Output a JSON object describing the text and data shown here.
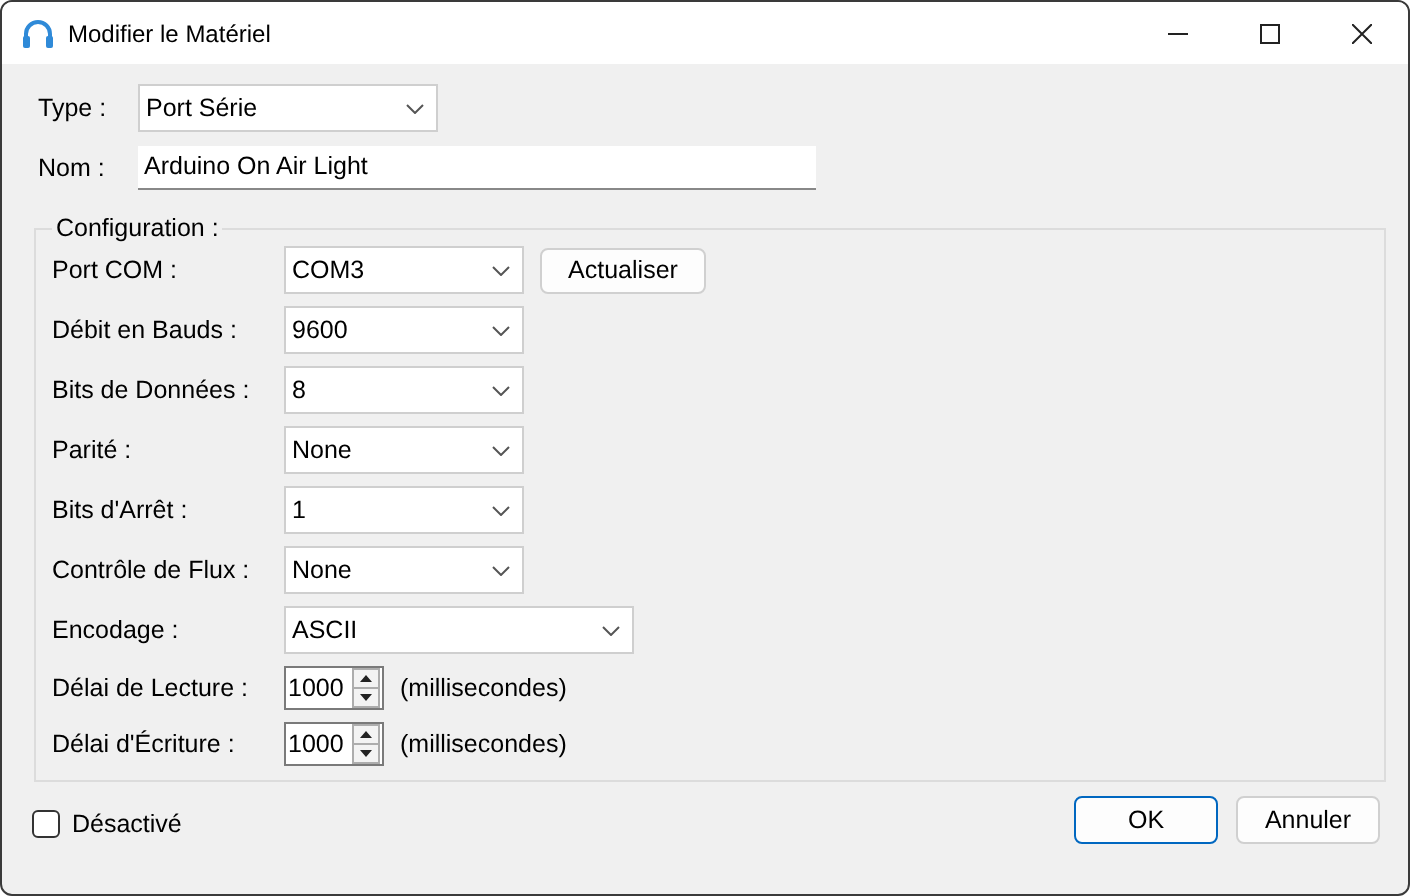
{
  "window": {
    "title": "Modifier le Matériel"
  },
  "general": [
    {
      "label": "Type :",
      "kind": "combo",
      "value": "Port Série"
    },
    {
      "label": "Nom :",
      "kind": "text",
      "value": "Arduino On Air Light"
    }
  ],
  "configuration": {
    "title": "Configuration :",
    "fields": [
      {
        "label": "Port COM :",
        "kind": "combo",
        "value": "COM3",
        "button": "Actualiser"
      },
      {
        "label": "Débit en Bauds :",
        "kind": "combo",
        "value": "9600"
      },
      {
        "label": "Bits de Données :",
        "kind": "combo",
        "value": "8"
      },
      {
        "label": "Parité :",
        "kind": "combo",
        "value": "None"
      },
      {
        "label": "Bits d'Arrêt :",
        "kind": "combo",
        "value": "1"
      },
      {
        "label": "Contrôle de Flux :",
        "kind": "combo",
        "value": "None"
      },
      {
        "label": "Encodage :",
        "kind": "wide-combo",
        "value": "ASCII"
      },
      {
        "label": "Délai de Lecture :",
        "kind": "spin",
        "value": "1000",
        "unit": "(millisecondes)"
      },
      {
        "label": "Délai d'Écriture :",
        "kind": "spin",
        "value": "1000",
        "unit": "(millisecondes)"
      }
    ]
  },
  "disabled_checkbox": {
    "label": "Désactivé",
    "checked": false
  },
  "buttons": [
    {
      "label": "OK",
      "default": true
    },
    {
      "label": "Annuler",
      "default": false
    }
  ]
}
